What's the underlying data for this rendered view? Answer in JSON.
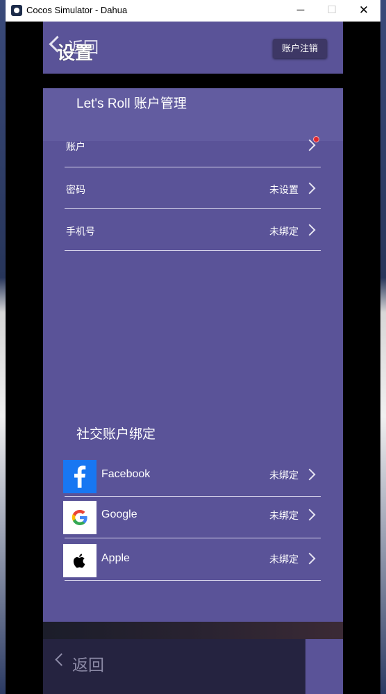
{
  "window": {
    "title": "Cocos Simulator - Dahua",
    "minimize": "─",
    "maximize": "☐",
    "close": "✕"
  },
  "header": {
    "back_label": "返回",
    "title": "设置",
    "deregister_label": "账户注销"
  },
  "account_section": {
    "title": "Let's Roll 账户管理",
    "rows": [
      {
        "label": "账户",
        "value": "",
        "has_badge": true
      },
      {
        "label": "密码",
        "value": "未设置"
      },
      {
        "label": "手机号",
        "value": "未绑定"
      }
    ]
  },
  "social_section": {
    "title": "社交账户绑定",
    "rows": [
      {
        "label": "Facebook",
        "value": "未绑定",
        "icon": "facebook-icon"
      },
      {
        "label": "Google",
        "value": "未绑定",
        "icon": "google-icon"
      },
      {
        "label": "Apple",
        "value": "未绑定",
        "icon": "apple-icon"
      }
    ]
  },
  "footer": {
    "back_label": "返回"
  },
  "colors": {
    "panel": "#5a5398",
    "header_band": "#625ca0",
    "button": "#3d3765",
    "footer": "#252340",
    "badge": "#e0282e",
    "facebook": "#1877f2"
  }
}
